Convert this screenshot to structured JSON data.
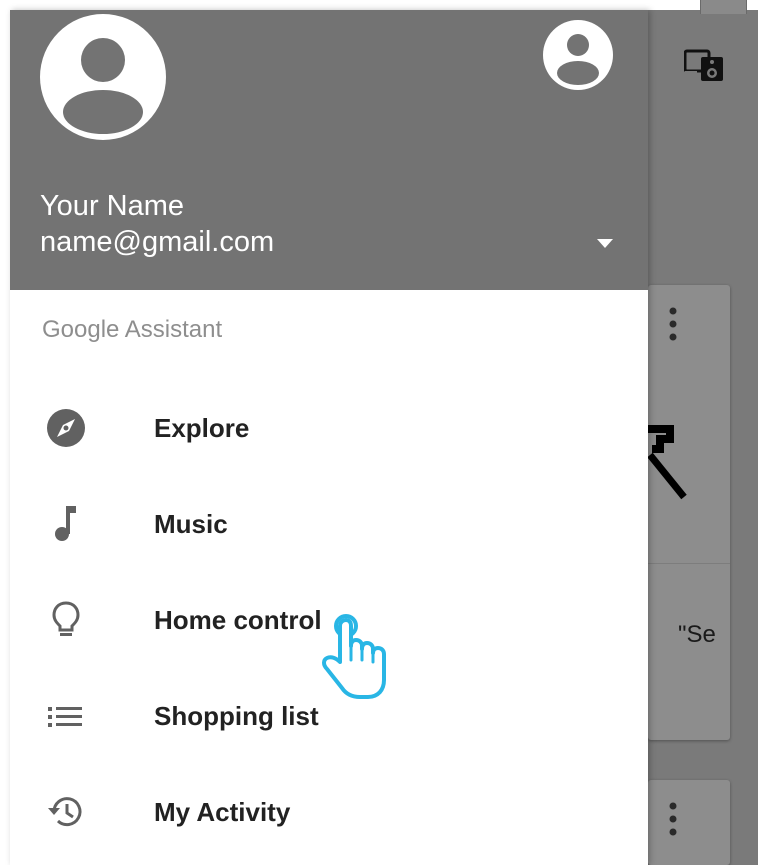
{
  "background": {
    "card_snippet": "\"Se"
  },
  "drawer": {
    "header": {
      "name": "Your Name",
      "email": "name@gmail.com"
    },
    "section_label": "Google Assistant",
    "items": [
      {
        "label": "Explore",
        "icon": "compass-icon"
      },
      {
        "label": "Music",
        "icon": "music-note-icon"
      },
      {
        "label": "Home control",
        "icon": "lightbulb-icon"
      },
      {
        "label": "Shopping list",
        "icon": "list-icon"
      },
      {
        "label": "My Activity",
        "icon": "history-icon"
      }
    ]
  },
  "colors": {
    "header_bg": "#737373",
    "scrim": "#7a7a7a",
    "cursor_accent": "#29b6e5"
  }
}
